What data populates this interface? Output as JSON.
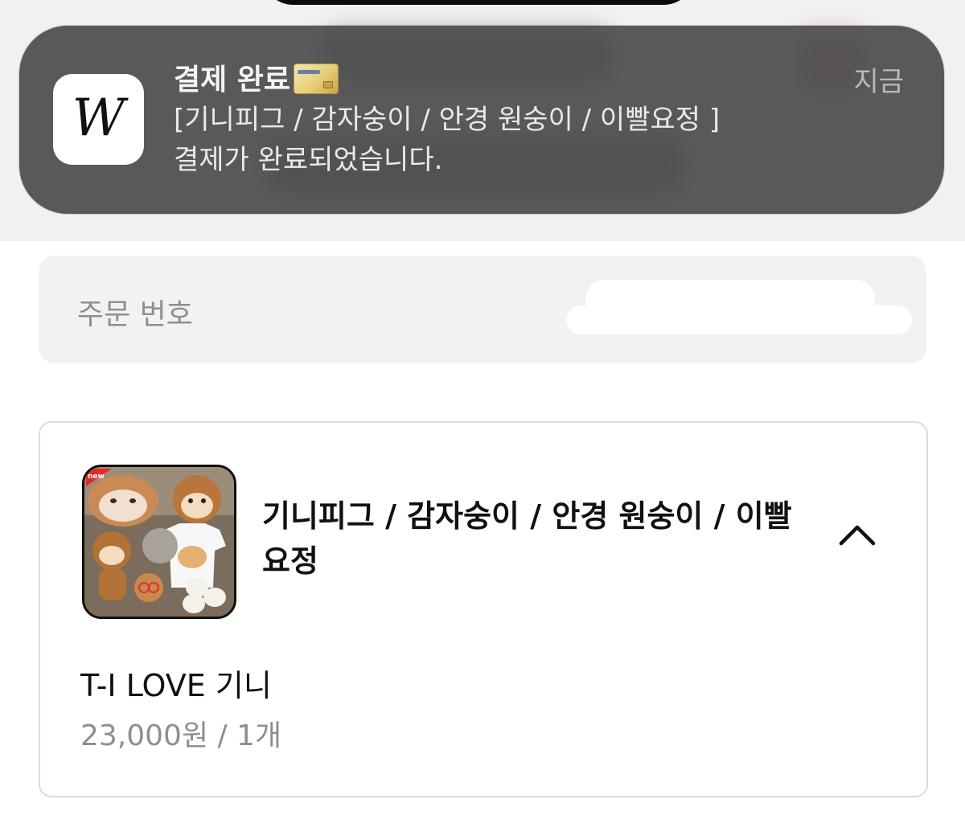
{
  "notification": {
    "app_icon_letter": "W",
    "title": "결제 완료",
    "title_emoji": "credit-card-emoji",
    "time": "지금",
    "body_line1": "[기니피그 / 감자숭이 / 안경 원숭이 / 이빨요정 ]",
    "body_line2": "결제가 완료되었습니다."
  },
  "order": {
    "label": "주문 번호"
  },
  "product": {
    "title": "기니피그 / 감자숭이 / 안경 원숭이 / 이빨요정",
    "thumbnail_badge": "new",
    "option_name": "T-I LOVE 기니",
    "option_price": "23,000원 / 1개",
    "expanded": true
  },
  "colors": {
    "notification_bg": "#4e4e50",
    "secondary_text": "#8e8e93",
    "order_box_bg": "#f2f2f5",
    "card_border": "#dcdce0"
  }
}
